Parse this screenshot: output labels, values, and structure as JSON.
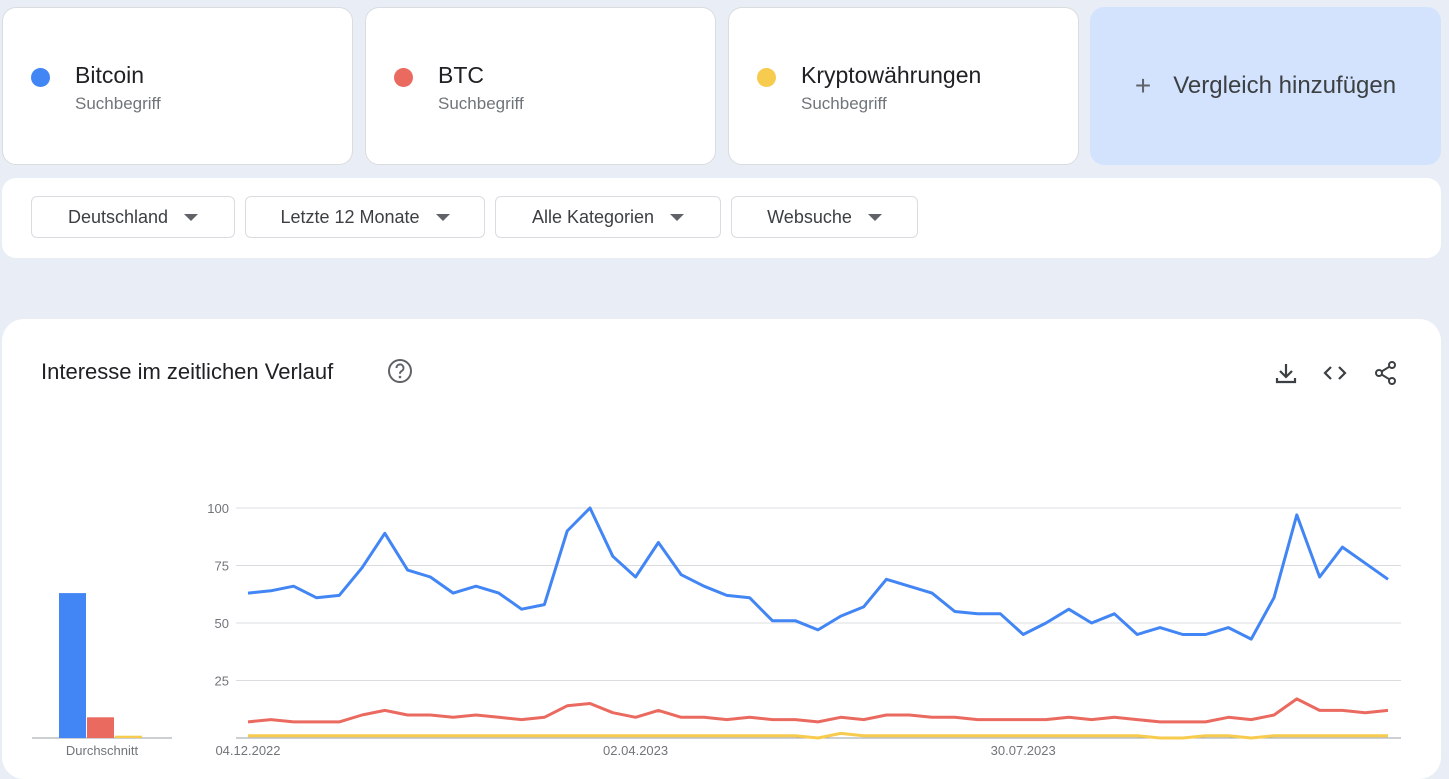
{
  "terms": [
    {
      "name": "Bitcoin",
      "type": "Suchbegriff",
      "color": "#4285f4"
    },
    {
      "name": "BTC",
      "type": "Suchbegriff",
      "color": "#ea6a60"
    },
    {
      "name": "Kryptowährungen",
      "type": "Suchbegriff",
      "color": "#f7cb4d"
    }
  ],
  "add_compare": {
    "icon": "plus-icon",
    "label": "Vergleich hinzufügen"
  },
  "filters": {
    "region": "Deutschland",
    "time": "Letzte 12 Monate",
    "category": "Alle Kategorien",
    "search_type": "Websuche"
  },
  "chart_section": {
    "title": "Interesse im zeitlichen Verlauf",
    "icons": [
      "help-icon",
      "download-icon",
      "embed-icon",
      "share-icon"
    ]
  },
  "chart_data": [
    {
      "type": "bar",
      "categories": [
        "Durchschnitt"
      ],
      "series": [
        {
          "name": "Bitcoin",
          "values": [
            63
          ],
          "color": "#4285f4"
        },
        {
          "name": "BTC",
          "values": [
            9
          ],
          "color": "#ea6a60"
        },
        {
          "name": "Kryptowährungen",
          "values": [
            1
          ],
          "color": "#f7cb4d"
        }
      ],
      "xlabel": "Durchschnitt",
      "ylim": [
        0,
        100
      ]
    },
    {
      "type": "line",
      "x_tick_labels": [
        "04.12.2022",
        "02.04.2023",
        "30.07.2023"
      ],
      "y_ticks": [
        25,
        50,
        75,
        100
      ],
      "ylim": [
        0,
        100
      ],
      "grid": true,
      "series": [
        {
          "name": "Bitcoin",
          "color": "#4285f4",
          "values": [
            63,
            64,
            66,
            61,
            62,
            74,
            89,
            73,
            70,
            63,
            66,
            63,
            56,
            58,
            90,
            100,
            79,
            70,
            85,
            71,
            66,
            62,
            61,
            51,
            51,
            47,
            53,
            57,
            69,
            66,
            63,
            55,
            54,
            54,
            45,
            50,
            56,
            50,
            54,
            45,
            48,
            45,
            45,
            48,
            43,
            61,
            97,
            70,
            83,
            76,
            69
          ]
        },
        {
          "name": "BTC",
          "color": "#ea6a60",
          "values": [
            7,
            8,
            7,
            7,
            7,
            10,
            12,
            10,
            10,
            9,
            10,
            9,
            8,
            9,
            14,
            15,
            11,
            9,
            12,
            9,
            9,
            8,
            9,
            8,
            8,
            7,
            9,
            8,
            10,
            10,
            9,
            9,
            8,
            8,
            8,
            8,
            9,
            8,
            9,
            8,
            7,
            7,
            7,
            9,
            8,
            10,
            17,
            12,
            12,
            11,
            12
          ]
        },
        {
          "name": "Kryptowährungen",
          "color": "#f7cb4d",
          "values": [
            1,
            1,
            1,
            1,
            1,
            1,
            1,
            1,
            1,
            1,
            1,
            1,
            1,
            1,
            1,
            1,
            1,
            1,
            1,
            1,
            1,
            1,
            1,
            1,
            1,
            0,
            2,
            1,
            1,
            1,
            1,
            1,
            1,
            1,
            1,
            1,
            1,
            1,
            1,
            1,
            0,
            0,
            1,
            1,
            0,
            1,
            1,
            1,
            1,
            1,
            1
          ]
        }
      ]
    }
  ]
}
